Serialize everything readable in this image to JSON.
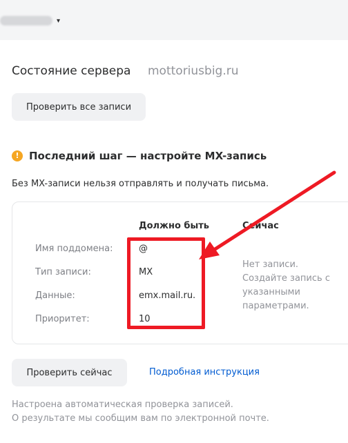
{
  "header": {
    "account_name": "",
    "caret_glyph": "▾"
  },
  "status": {
    "title": "Состояние сервера",
    "domain": "mottoriusbig.ru",
    "check_all_label": "Проверить все записи"
  },
  "step": {
    "warning_glyph": "!",
    "title": "Последний шаг — настройте MX-запись",
    "description": "Без MX-записи нельзя отправлять и получать письма."
  },
  "record": {
    "headers": {
      "should_be": "Должно быть",
      "current": "Сейчас"
    },
    "rows": [
      {
        "label": "Имя поддомена:",
        "value": "@"
      },
      {
        "label": "Тип записи:",
        "value": "MX"
      },
      {
        "label": "Данные:",
        "value": "emx.mail.ru."
      },
      {
        "label": "Приоритет:",
        "value": "10"
      }
    ],
    "current_text": "Нет записи. Создайте запись с указанными параметрами."
  },
  "actions": {
    "check_now_label": "Проверить сейчас",
    "instruction_link": "Подробная инструкция"
  },
  "footer": {
    "line1": "Настроена автоматическая проверка записей.",
    "line2": "О результате мы сообщим вам по электронной почте."
  },
  "colors": {
    "annotation_red": "#ee1a24",
    "link_blue": "#005bd1",
    "warning_orange": "#f5a623"
  }
}
